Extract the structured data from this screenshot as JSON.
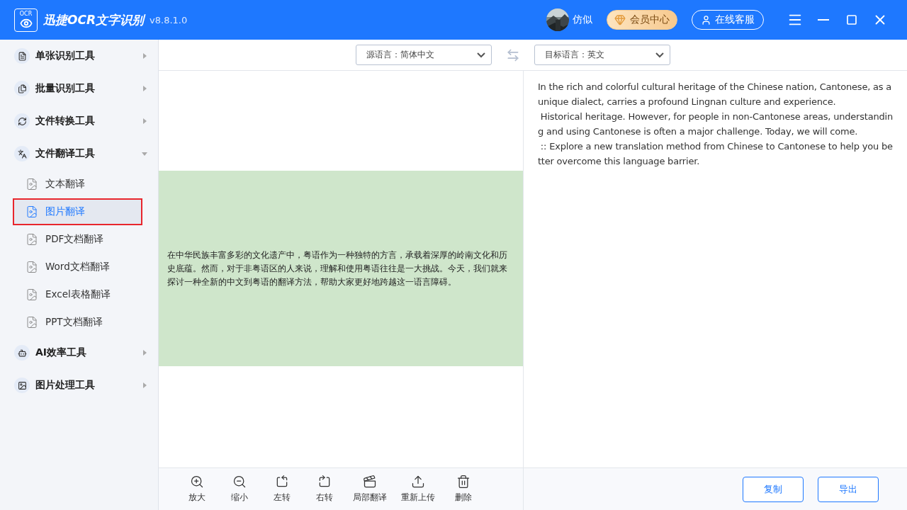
{
  "app": {
    "logo_text": "OCR",
    "title": "迅捷OCR文字识别",
    "version": "v8.8.1.0",
    "user_name": "仿似",
    "vip_button": "会员中心",
    "service_button": "在线客服"
  },
  "sidebar": {
    "groups": [
      {
        "label": "单张识别工具",
        "kind": "single",
        "expanded": false
      },
      {
        "label": "批量识别工具",
        "kind": "batch",
        "expanded": false
      },
      {
        "label": "文件转换工具",
        "kind": "convert",
        "expanded": false
      },
      {
        "label": "文件翻译工具",
        "kind": "translate",
        "expanded": true,
        "children": [
          {
            "label": "文本翻译",
            "selected": false
          },
          {
            "label": "图片翻译",
            "selected": true
          },
          {
            "label": "PDF文档翻译",
            "selected": false
          },
          {
            "label": "Word文档翻译",
            "selected": false
          },
          {
            "label": "Excel表格翻译",
            "selected": false
          },
          {
            "label": "PPT文档翻译",
            "selected": false
          }
        ]
      },
      {
        "label": "AI效率工具",
        "kind": "ai",
        "expanded": false
      },
      {
        "label": "图片处理工具",
        "expanded": false
      }
    ]
  },
  "language_bar": {
    "source": "源语言：简体中文",
    "target": "目标语言：英文"
  },
  "source_text": "在中华民族丰富多彩的文化遗产中，粤语作为一种独特的方言，承载着深厚的岭南文化和历史底蕴。然而，对于非粤语区的人来说，理解和使用粤语往往是一大挑战。今天，我们就来探讨一种全新的中文到粤语的翻译方法，帮助大家更好地跨越这一语言障碍。",
  "result_lines": [
    "In the rich and colorful cultural heritage of the Chinese nation, Cantonese, as a",
    "unique dialect, carries a profound Lingnan culture and experience.",
    " Historical heritage. However, for people in non-Cantonese areas, understandin",
    "g and using Cantonese is often a major challenge. Today, we will come.",
    " :: Explore a new translation method from Chinese to Cantonese to help you be",
    "tter overcome this language barrier."
  ],
  "image_tools": [
    {
      "label": "放大",
      "kind": "zoom_in"
    },
    {
      "label": "缩小",
      "kind": "zoom_out"
    },
    {
      "label": "左转",
      "kind": "rotate_left"
    },
    {
      "label": "右转",
      "kind": "rotate_right"
    },
    {
      "label": "局部翻译",
      "kind": "partial"
    },
    {
      "label": "重新上传",
      "kind": "upload"
    },
    {
      "label": "删除",
      "kind": "delete"
    }
  ],
  "result_buttons": [
    "复制",
    "导出"
  ]
}
